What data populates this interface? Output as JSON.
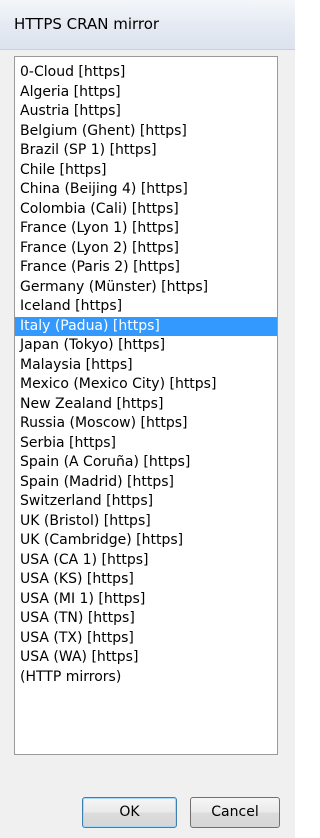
{
  "window": {
    "title": "HTTPS CRAN mirror"
  },
  "mirror_list": {
    "selected_index": 13,
    "items": [
      "0-Cloud [https]",
      "Algeria [https]",
      "Austria [https]",
      "Belgium (Ghent) [https]",
      "Brazil (SP 1) [https]",
      "Chile [https]",
      "China (Beijing 4) [https]",
      "Colombia (Cali) [https]",
      "France (Lyon 1) [https]",
      "France (Lyon 2) [https]",
      "France (Paris 2) [https]",
      "Germany (Münster) [https]",
      "Iceland [https]",
      "Italy (Padua) [https]",
      "Japan (Tokyo) [https]",
      "Malaysia [https]",
      "Mexico (Mexico City) [https]",
      "New Zealand [https]",
      "Russia (Moscow) [https]",
      "Serbia [https]",
      "Spain (A Coruña) [https]",
      "Spain (Madrid) [https]",
      "Switzerland [https]",
      "UK (Bristol) [https]",
      "UK (Cambridge) [https]",
      "USA (CA 1) [https]",
      "USA (KS) [https]",
      "USA (MI 1) [https]",
      "USA (TN) [https]",
      "USA (TX) [https]",
      "USA (WA) [https]",
      "(HTTP mirrors)"
    ]
  },
  "buttons": {
    "ok_label": "OK",
    "cancel_label": "Cancel"
  },
  "colors": {
    "selection": "#3399ff",
    "selection_text": "#ffffff",
    "window_bg": "#f0f0f0"
  }
}
